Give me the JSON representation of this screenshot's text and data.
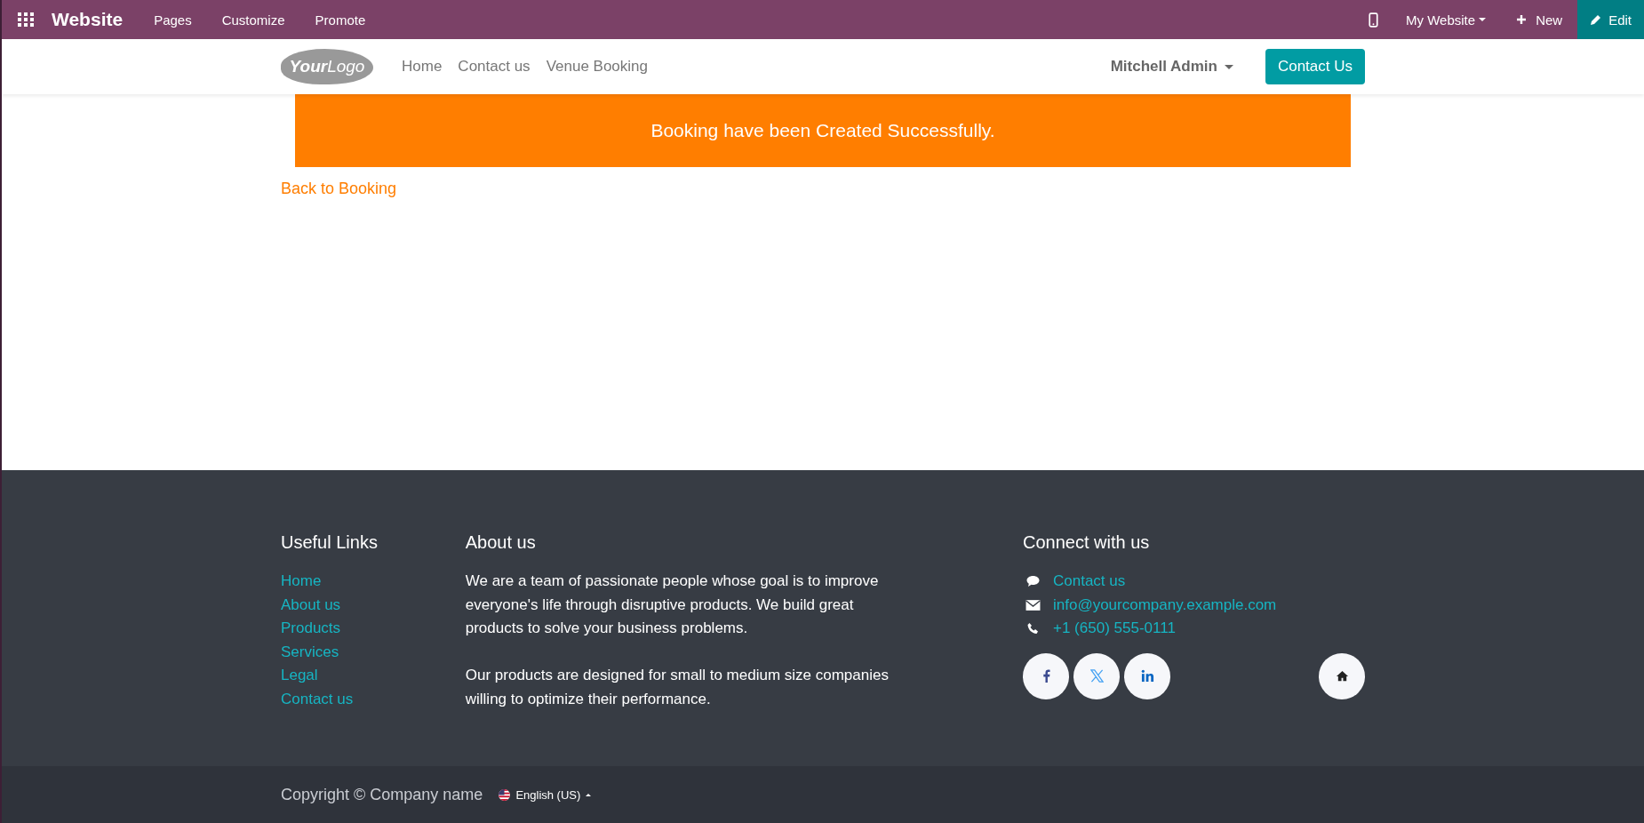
{
  "top_bar": {
    "app_name": "Website",
    "menu": [
      "Pages",
      "Customize",
      "Promote"
    ],
    "site_switcher": "My Website",
    "new_button": "New",
    "edit_button": "Edit"
  },
  "header": {
    "logo": [
      "Your",
      "Logo"
    ],
    "nav": [
      "Home",
      "Contact us",
      "Venue Booking"
    ],
    "user": "Mitchell Admin",
    "cta": "Contact Us"
  },
  "alert": {
    "message": "Booking have been Created Successfully."
  },
  "back_link": "Back to Booking",
  "footer": {
    "useful_links": {
      "title": "Useful Links",
      "links": [
        "Home",
        "About us",
        "Products",
        "Services",
        "Legal",
        "Contact us"
      ]
    },
    "about": {
      "title": "About us",
      "paragraphs": [
        "We are a team of passionate people whose goal is to improve everyone's life through disruptive products. We build great products to solve your business problems.",
        "Our products are designed for small to medium size companies willing to optimize their performance."
      ]
    },
    "connect": {
      "title": "Connect with us",
      "items": [
        {
          "kind": "chat",
          "text": "Contact us"
        },
        {
          "kind": "mail",
          "text": "info@yourcompany.example.com"
        },
        {
          "kind": "phone",
          "text": "+1 (650) 555-0111"
        }
      ],
      "socials": [
        {
          "kind": "facebook"
        },
        {
          "kind": "x"
        },
        {
          "kind": "linkedin"
        }
      ]
    }
  },
  "copyright": {
    "text": "Copyright © Company name",
    "language": "English (US)"
  }
}
